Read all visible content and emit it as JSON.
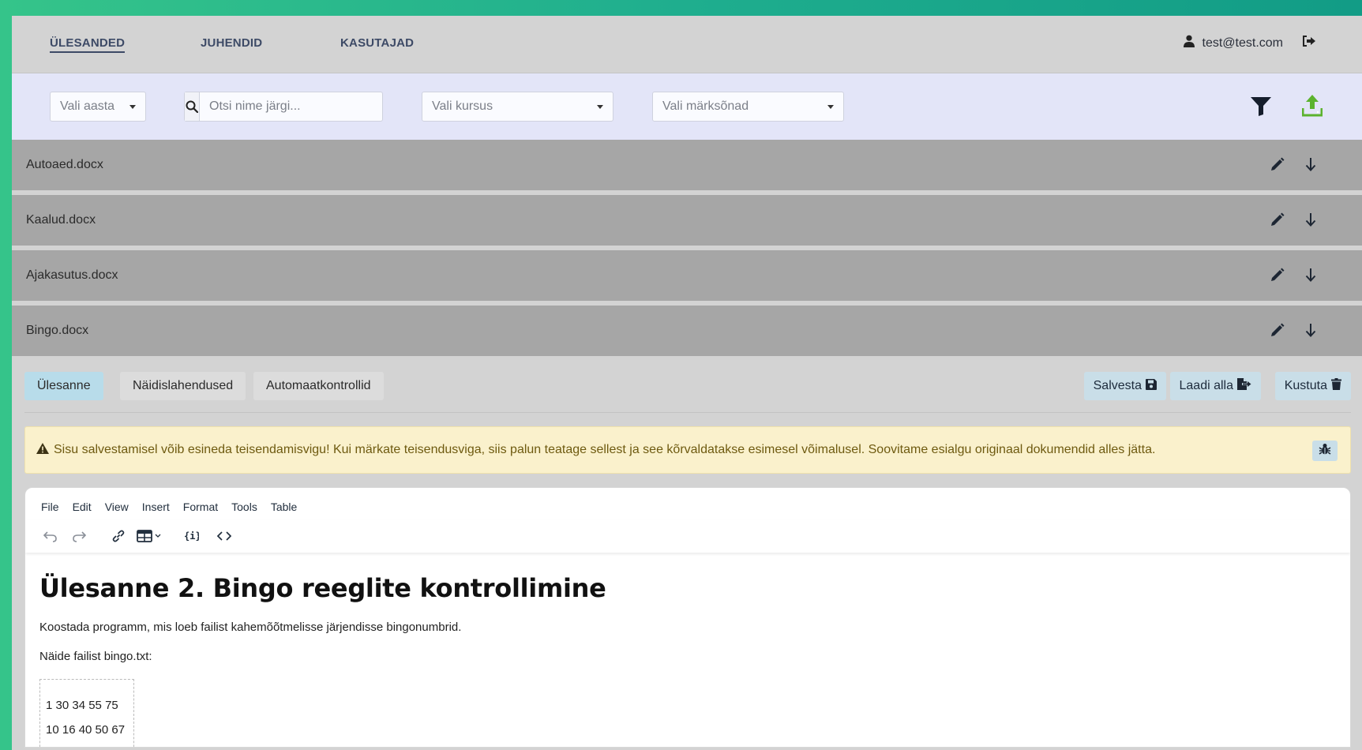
{
  "nav": {
    "tabs": [
      {
        "label": "ÜLESANDED"
      },
      {
        "label": "JUHENDID"
      },
      {
        "label": "KASUTAJAD"
      }
    ],
    "user_email": "test@test.com"
  },
  "filters": {
    "year_placeholder": "Vali aasta",
    "search_placeholder": "Otsi nime järgi...",
    "course_placeholder": "Vali kursus",
    "keywords_placeholder": "Vali märksõnad"
  },
  "files": [
    {
      "name": "Autoaed.docx"
    },
    {
      "name": "Kaalud.docx"
    },
    {
      "name": "Ajakasutus.docx"
    },
    {
      "name": "Bingo.docx"
    }
  ],
  "editor_tabs": [
    {
      "label": "Ülesanne"
    },
    {
      "label": "Näidislahendused"
    },
    {
      "label": "Automaatkontrollid"
    }
  ],
  "actions": {
    "save_label": "Salvesta",
    "download_label": "Laadi alla",
    "delete_label": "Kustuta"
  },
  "warning_text": "Sisu salvestamisel võib esineda teisendamisvigu! Kui märkate teisendusviga, siis palun teatage sellest ja see kõrvaldatakse esimesel võimalusel. Soovitame esialgu originaal dokumendid alles jätta.",
  "editor_menu": [
    "File",
    "Edit",
    "View",
    "Insert",
    "Format",
    "Tools",
    "Table"
  ],
  "document": {
    "heading": "Ülesanne 2. Bingo reeglite kontrollimine",
    "paragraph1": "Koostada programm, mis loeb failist kahemõõtmelisse järjendisse bingonumbrid.",
    "paragraph2": "Näide failist bingo.txt:",
    "code_lines": [
      "1 30 34 55 75",
      "10 16 40 50 67"
    ]
  },
  "colors": {
    "accent_green": "#35c48a",
    "upload_green": "#5cb32e",
    "nav_text": "#3d4a66",
    "warning_bg": "#faf1cc"
  }
}
